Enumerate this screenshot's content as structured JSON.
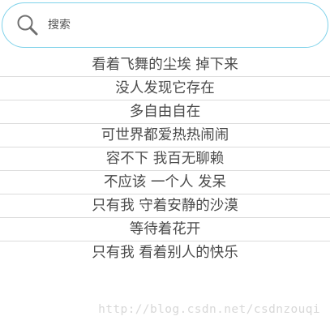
{
  "search": {
    "placeholder": "搜索",
    "icon": "search-icon"
  },
  "list": {
    "items": [
      "看着飞舞的尘埃 掉下来",
      "没人发现它存在",
      "多自由自在",
      "可世界都爱热热闹闹",
      "容不下 我百无聊赖",
      "不应该 一个人 发呆",
      "只有我 守着安静的沙漠",
      "等待着花开",
      "只有我 看着别人的快乐"
    ]
  },
  "watermark": {
    "text": "http://blog.csdn.net/csdnzouqi"
  },
  "colors": {
    "search_border": "#7fd2ea",
    "divider": "#dcdcdc",
    "text": "#4a4a4a"
  }
}
